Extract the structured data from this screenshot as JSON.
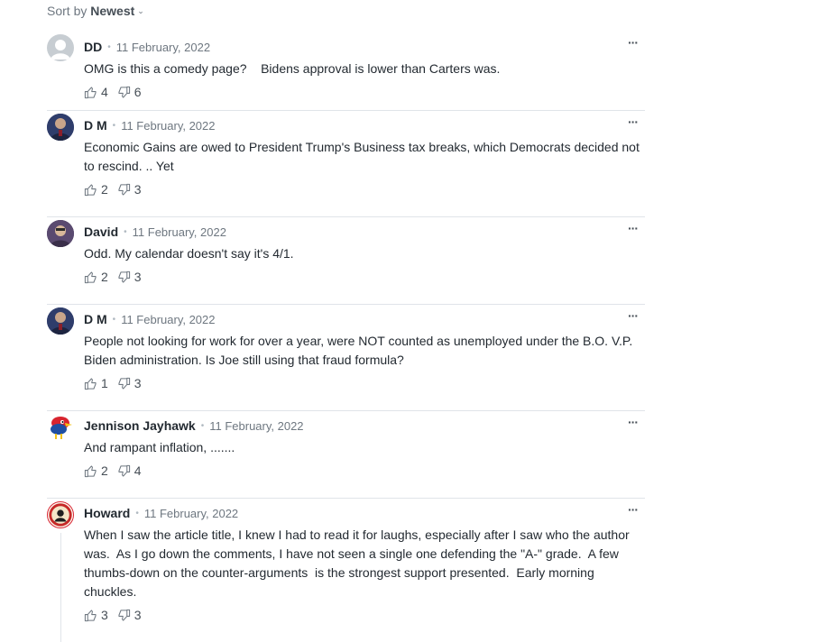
{
  "sort": {
    "prefix": "Sort by",
    "selected": "Newest"
  },
  "comments": [
    {
      "author": "DD",
      "date": "11 February, 2022",
      "text": "OMG is this a comedy page?    Bidens approval is lower than Carters was.",
      "up": "4",
      "down": "6",
      "avatar": "default-avatar-icon"
    },
    {
      "author": "D M",
      "date": "11 February, 2022",
      "text": "Economic Gains are owed to President Trump's Business tax breaks, which Democrats decided not to rescind. .. Yet",
      "up": "2",
      "down": "3",
      "avatar": "photo-avatar"
    },
    {
      "author": "David",
      "date": "11 February, 2022",
      "text": "Odd. My calendar doesn't say it's 4/1.",
      "up": "2",
      "down": "3",
      "avatar": "photo-avatar"
    },
    {
      "author": "D M",
      "date": "11 February, 2022",
      "text": "People not looking for work for over a year, were NOT counted as unemployed under the B.O. V.P. Biden administration. Is Joe still using that fraud formula?",
      "up": "1",
      "down": "3",
      "avatar": "photo-avatar"
    },
    {
      "author": "Jennison Jayhawk",
      "date": "11 February, 2022",
      "text": "And rampant inflation, .......",
      "up": "2",
      "down": "4",
      "avatar": "jayhawk-mascot-avatar"
    },
    {
      "author": "Howard",
      "date": "11 February, 2022",
      "text": "When I saw the article title, I knew I had to read it for laughs, especially after I saw who the author was.  As I go down the comments, I have not seen a single one defending the \"A-\" grade.  A few thumbs-down on the counter-arguments  is the strongest support presented.  Early morning chuckles.",
      "up": "3",
      "down": "3",
      "avatar": "badge-avatar"
    }
  ],
  "icons": {
    "more": "more-options-icon",
    "up": "thumbs-up-icon",
    "down": "thumbs-down-icon"
  }
}
